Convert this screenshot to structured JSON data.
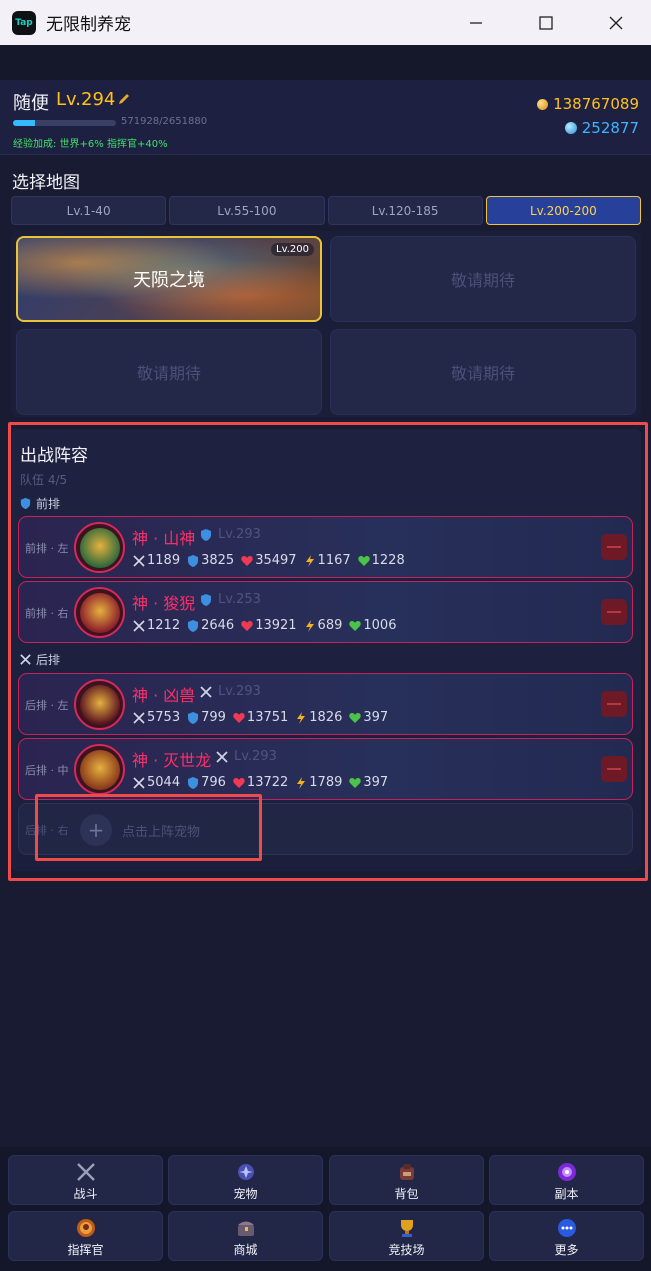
{
  "window": {
    "app_icon_text": "Tap",
    "title": "无限制养宠"
  },
  "player": {
    "name": "随便",
    "level": "Lv.294",
    "xp_text": "571928/2651880",
    "xp_progress": 0.216,
    "exp_bonus": "经验加成: 世界+6% 指挥官+40%",
    "gold": "138767089",
    "gems": "252877"
  },
  "map": {
    "title": "选择地图",
    "tabs": [
      {
        "label": "Lv.1-40",
        "active": false
      },
      {
        "label": "Lv.55-100",
        "active": false
      },
      {
        "label": "Lv.120-185",
        "active": false
      },
      {
        "label": "Lv.200-200",
        "active": true
      }
    ],
    "cells": [
      {
        "name": "天陨之境",
        "level": "Lv.200"
      },
      {
        "name": "敬请期待"
      },
      {
        "name": "敬请期待"
      },
      {
        "name": "敬请期待"
      }
    ]
  },
  "lineup": {
    "title": "出战阵容",
    "team_count": "队伍 4/5",
    "front_label": "前排",
    "back_label": "后排",
    "pets": [
      {
        "slot": "前排 · 左",
        "name": "神 · 山神",
        "type": "shield",
        "level": "Lv.293",
        "atk": "1189",
        "def": "3825",
        "hp": "35497",
        "spd": "1167",
        "heal": "1228",
        "color": "#2f6a3a"
      },
      {
        "slot": "前排 · 右",
        "name": "神 · 狻猊",
        "type": "shield",
        "level": "Lv.253",
        "atk": "1212",
        "def": "2646",
        "hp": "13921",
        "spd": "689",
        "heal": "1006",
        "color": "#8c1f2a"
      },
      {
        "slot": "后排 · 左",
        "name": "神 · 凶兽",
        "type": "sword",
        "level": "Lv.293",
        "atk": "5753",
        "def": "799",
        "hp": "13751",
        "spd": "1826",
        "heal": "397",
        "color": "#5a1420"
      },
      {
        "slot": "后排 · 中",
        "name": "神 · 灭世龙",
        "type": "sword",
        "level": "Lv.293",
        "atk": "5044",
        "def": "796",
        "hp": "13722",
        "spd": "1789",
        "heal": "397",
        "color": "#8a3a1a"
      }
    ],
    "empty_slot": {
      "slot": "后排 · 右",
      "text": "点击上阵宠物"
    }
  },
  "nav": [
    {
      "label": "战斗",
      "icon": "swords-icon"
    },
    {
      "label": "宠物",
      "icon": "pet-orb-icon"
    },
    {
      "label": "背包",
      "icon": "backpack-icon"
    },
    {
      "label": "副本",
      "icon": "dungeon-portal-icon"
    },
    {
      "label": "指挥官",
      "icon": "commander-icon"
    },
    {
      "label": "商城",
      "icon": "shop-chest-icon"
    },
    {
      "label": "竞技场",
      "icon": "arena-trophy-icon"
    },
    {
      "label": "更多",
      "icon": "more-dots-icon"
    }
  ]
}
